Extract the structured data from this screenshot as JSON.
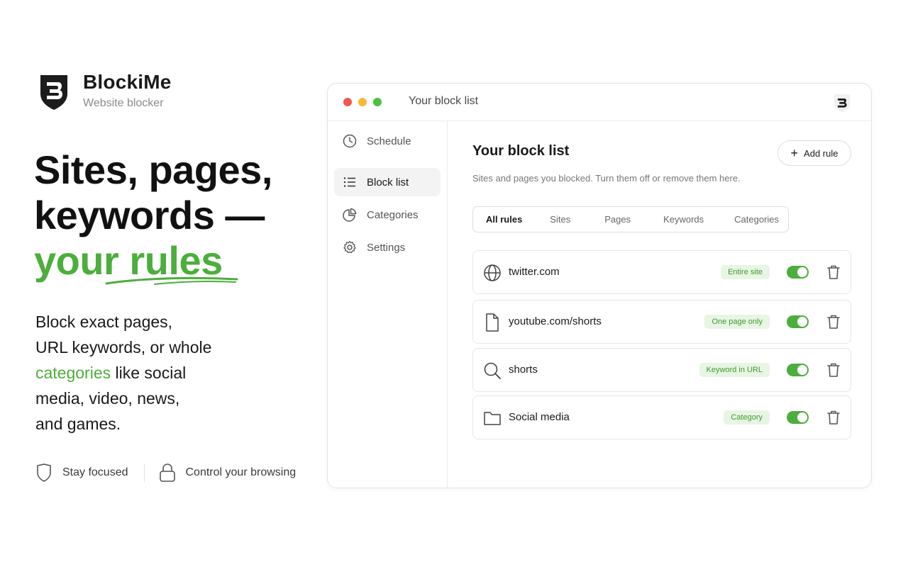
{
  "brand": {
    "name": "BlockiMe",
    "subtitle": "Website blocker"
  },
  "hero": {
    "headline_line1": "Sites, pages,",
    "headline_line2": "keywords —",
    "headline_accent": "your rules",
    "desc_line1": "Block exact pages,",
    "desc_line2": "URL keywords, or whole",
    "desc_highlight": "categories",
    "desc_line3_rest": " like social",
    "desc_line4": "media, video, news,",
    "desc_line5": "and games."
  },
  "features": [
    {
      "label": "Stay focused",
      "icon": "shield-icon"
    },
    {
      "label": "Control your browsing",
      "icon": "lock-icon"
    }
  ],
  "window": {
    "title": "Your block list",
    "sidebar": [
      {
        "label": "Schedule",
        "icon": "clock-icon",
        "active": false
      },
      {
        "label": "Block list",
        "icon": "list-icon",
        "active": true
      },
      {
        "label": "Categories",
        "icon": "pie-chart-icon",
        "active": false
      },
      {
        "label": "Settings",
        "icon": "gear-icon",
        "active": false
      }
    ],
    "main": {
      "title": "Your block list",
      "subtitle": "Sites and pages you blocked. Turn them off or remove them here.",
      "add_button": "Add rule",
      "tabs": [
        "All rules",
        "Sites",
        "Pages",
        "Keywords",
        "Categories"
      ],
      "active_tab": "All rules",
      "rules": [
        {
          "name": "twitter.com",
          "badge": "Entire site",
          "icon": "globe-icon",
          "enabled": true
        },
        {
          "name": "youtube.com/shorts",
          "badge": "One page only",
          "icon": "file-icon",
          "enabled": true
        },
        {
          "name": "shorts",
          "badge": "Keyword in URL",
          "icon": "search-icon",
          "enabled": true
        },
        {
          "name": "Social media",
          "badge": "Category",
          "icon": "folder-icon",
          "enabled": true
        }
      ]
    }
  },
  "colors": {
    "accent": "#4cae3c",
    "badge_bg": "#e7f5e3",
    "dot_red": "#f0584f",
    "dot_yellow": "#f7b935",
    "dot_green": "#4cbf3f"
  }
}
